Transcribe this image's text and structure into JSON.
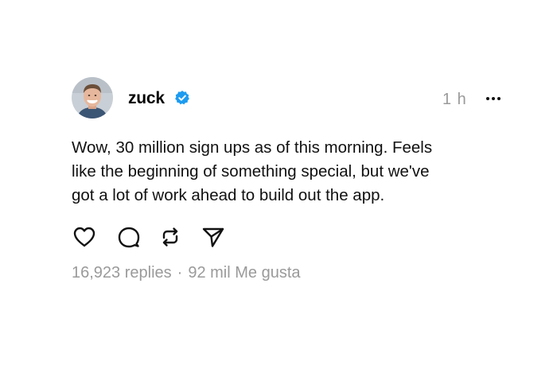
{
  "post": {
    "author": {
      "username": "zuck",
      "verified": true
    },
    "time_ago": "1 h",
    "text_lines": [
      "Wow, 30 million sign ups as of this morning. Feels",
      "like the beginning of something special, but we've",
      "got a lot of work ahead to build out the app."
    ],
    "actions": [
      {
        "name": "like",
        "icon": "heart-icon"
      },
      {
        "name": "reply",
        "icon": "comment-bubble-icon"
      },
      {
        "name": "repost",
        "icon": "repost-arrows-icon"
      },
      {
        "name": "share",
        "icon": "send-paper-plane-icon"
      }
    ],
    "stats": {
      "replies": "16,923 replies",
      "separator": "·",
      "likes": "92 mil Me gusta"
    }
  },
  "colors": {
    "verified_badge": "#1d9bf0",
    "muted_text": "#9a9a9a",
    "text": "#000000",
    "background": "#ffffff"
  }
}
